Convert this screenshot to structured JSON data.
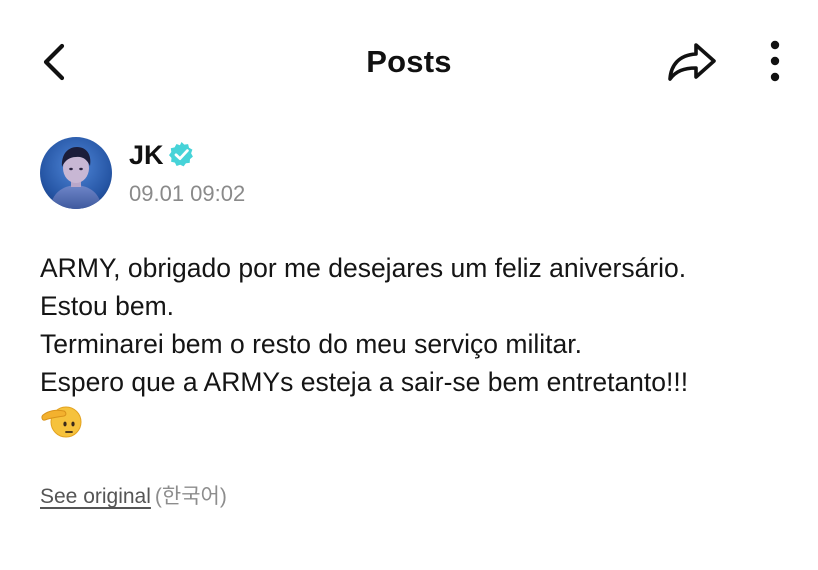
{
  "header": {
    "title": "Posts",
    "back_icon": "chevron-left-icon",
    "share_icon": "share-forward-icon",
    "more_icon": "more-vertical-icon"
  },
  "author": {
    "name": "JK",
    "verified": true,
    "verified_color": "#46d3d8",
    "timestamp": "09.01 09:02"
  },
  "post": {
    "lines": [
      "ARMY, obrigado por me desejares um feliz aniversário.",
      "Estou bem.",
      "Terminarei bem o resto do meu serviço militar.",
      "Espero que a ARMYs esteja a sair-se bem entretanto!!!"
    ],
    "emoji": "saluting-face-emoji"
  },
  "translation": {
    "see_original_label": "See original",
    "language": "(한국어)"
  },
  "colors": {
    "background": "#ffffff",
    "text": "#111111",
    "secondary_text": "#8a8a8a",
    "avatar_bg": "#2f5fa8"
  }
}
